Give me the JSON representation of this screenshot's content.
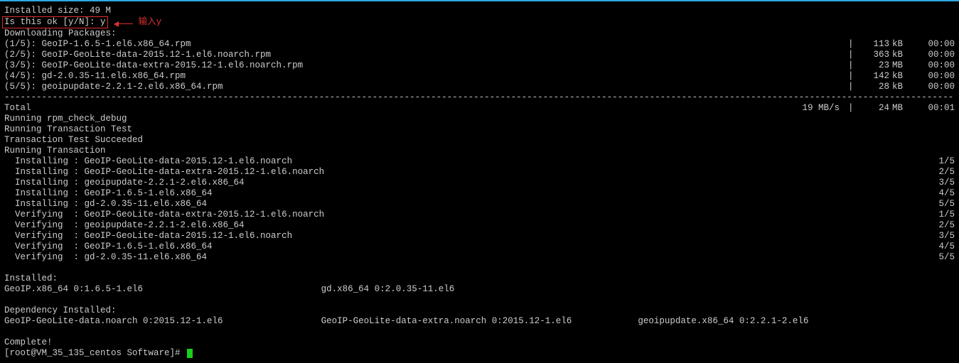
{
  "header": {
    "installed_size_label": "Installed size: 49 M",
    "prompt_boxed": "Is this ok [y/N]: y",
    "annotation": "输入y",
    "downloading": "Downloading Packages:"
  },
  "downloads": [
    {
      "left": "(1/5): GeoIP-1.6.5-1.el6.x86_64.rpm",
      "size": "113",
      "unit": "kB",
      "time": "00:00"
    },
    {
      "left": "(2/5): GeoIP-GeoLite-data-2015.12-1.el6.noarch.rpm",
      "size": "363",
      "unit": "kB",
      "time": "00:00"
    },
    {
      "left": "(3/5): GeoIP-GeoLite-data-extra-2015.12-1.el6.noarch.rpm",
      "size": "23",
      "unit": "MB",
      "time": "00:00"
    },
    {
      "left": "(4/5): gd-2.0.35-11.el6.x86_64.rpm",
      "size": "142",
      "unit": "kB",
      "time": "00:00"
    },
    {
      "left": "(5/5): geoipupdate-2.2.1-2.el6.x86_64.rpm",
      "size": "28",
      "unit": "kB",
      "time": "00:00"
    }
  ],
  "total": {
    "label": "Total",
    "rate": "19 MB/s",
    "size": "24",
    "unit": "MB",
    "time": "00:01"
  },
  "post": [
    "Running rpm_check_debug",
    "Running Transaction Test",
    "Transaction Test Succeeded",
    "Running Transaction"
  ],
  "trans": [
    {
      "left": "  Installing : GeoIP-GeoLite-data-2015.12-1.el6.noarch",
      "frac": "1/5"
    },
    {
      "left": "  Installing : GeoIP-GeoLite-data-extra-2015.12-1.el6.noarch",
      "frac": "2/5"
    },
    {
      "left": "  Installing : geoipupdate-2.2.1-2.el6.x86_64",
      "frac": "3/5"
    },
    {
      "left": "  Installing : GeoIP-1.6.5-1.el6.x86_64",
      "frac": "4/5"
    },
    {
      "left": "  Installing : gd-2.0.35-11.el6.x86_64",
      "frac": "5/5"
    },
    {
      "left": "  Verifying  : GeoIP-GeoLite-data-extra-2015.12-1.el6.noarch",
      "frac": "1/5"
    },
    {
      "left": "  Verifying  : geoipupdate-2.2.1-2.el6.x86_64",
      "frac": "2/5"
    },
    {
      "left": "  Verifying  : GeoIP-GeoLite-data-2015.12-1.el6.noarch",
      "frac": "3/5"
    },
    {
      "left": "  Verifying  : GeoIP-1.6.5-1.el6.x86_64",
      "frac": "4/5"
    },
    {
      "left": "  Verifying  : gd-2.0.35-11.el6.x86_64",
      "frac": "5/5"
    }
  ],
  "installed": {
    "header": "Installed:",
    "cols": [
      "  GeoIP.x86_64 0:1.6.5-1.el6",
      "gd.x86_64 0:2.0.35-11.el6",
      ""
    ]
  },
  "dep": {
    "header": "Dependency Installed:",
    "cols": [
      "  GeoIP-GeoLite-data.noarch 0:2015.12-1.el6",
      "GeoIP-GeoLite-data-extra.noarch 0:2015.12-1.el6",
      "geoipupdate.x86_64 0:2.2.1-2.el6"
    ]
  },
  "complete": "Complete!",
  "shell_prompt": "[root@VM_35_135_centos Software]# ",
  "dashline": "--------------------------------------------------------------------------------------------------------------------------------------------------------------------------------------------------------------------------"
}
